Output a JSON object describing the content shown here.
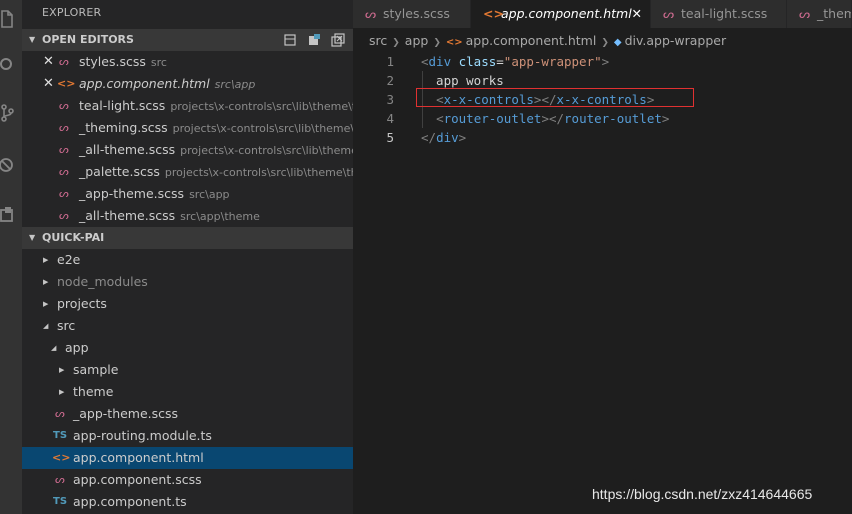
{
  "colors": {
    "activity_bar": "#333333",
    "sidebar_bg": "#252526",
    "editor_bg": "#1e1e1e",
    "selection": "#094771",
    "highlight_box": "#e03131",
    "sass_icon": "#cd6b8f",
    "html_icon": "#e37933",
    "ts_icon": "#519aba"
  },
  "activity_bar": {
    "items": [
      "files-icon",
      "search-icon",
      "source-control-icon",
      "debug-icon",
      "extensions-icon"
    ]
  },
  "sidebar": {
    "title": "EXPLORER",
    "open_editors": {
      "header": "OPEN EDITORS",
      "items": [
        {
          "name": "styles.scss",
          "path": "src",
          "icon": "sass-icon",
          "close": "✕"
        },
        {
          "name": "app.component.html",
          "path": "src\\app",
          "icon": "html-icon",
          "close": "✕"
        },
        {
          "name": "teal-light.scss",
          "path": "projects\\x-controls\\src\\lib\\theme\\t...",
          "icon": "sass-icon"
        },
        {
          "name": "_theming.scss",
          "path": "projects\\x-controls\\src\\lib\\theme\\t...",
          "icon": "sass-icon"
        },
        {
          "name": "_all-theme.scss",
          "path": "projects\\x-controls\\src\\lib\\theme...",
          "icon": "sass-icon"
        },
        {
          "name": "_palette.scss",
          "path": "projects\\x-controls\\src\\lib\\theme\\th...",
          "icon": "sass-icon"
        },
        {
          "name": "_app-theme.scss",
          "path": "src\\app",
          "icon": "sass-icon"
        },
        {
          "name": "_all-theme.scss",
          "path": "src\\app\\theme",
          "icon": "sass-icon"
        }
      ]
    },
    "project": {
      "header": "QUICK-PAI",
      "tree": [
        {
          "name": "e2e",
          "type": "folder",
          "expanded": false
        },
        {
          "name": "node_modules",
          "type": "folder",
          "expanded": false
        },
        {
          "name": "projects",
          "type": "folder",
          "expanded": false
        },
        {
          "name": "src",
          "type": "folder",
          "expanded": true
        },
        {
          "name": "app",
          "type": "folder",
          "expanded": true
        },
        {
          "name": "sample",
          "type": "folder",
          "expanded": false
        },
        {
          "name": "theme",
          "type": "folder",
          "expanded": false
        },
        {
          "name": "_app-theme.scss",
          "type": "file",
          "icon": "sass-icon"
        },
        {
          "name": "app-routing.module.ts",
          "type": "file",
          "icon": "ts-icon"
        },
        {
          "name": "app.component.html",
          "type": "file",
          "icon": "html-icon",
          "selected": true
        },
        {
          "name": "app.component.scss",
          "type": "file",
          "icon": "sass-icon"
        },
        {
          "name": "app.component.ts",
          "type": "file",
          "icon": "ts-icon"
        }
      ]
    }
  },
  "tabs": [
    {
      "label": "styles.scss",
      "icon": "sass-icon",
      "active": false
    },
    {
      "label": "app.component.html",
      "icon": "html-icon",
      "active": true,
      "close": "✕"
    },
    {
      "label": "teal-light.scss",
      "icon": "sass-icon",
      "active": false
    },
    {
      "label": "_them",
      "icon": "sass-icon",
      "active": false
    }
  ],
  "breadcrumb": [
    "src",
    "app",
    "app.component.html",
    "div.app-wrapper"
  ],
  "editor": {
    "line_numbers": [
      "1",
      "2",
      "3",
      "4",
      "5"
    ],
    "current_line": "5",
    "lines": [
      "<div class=\"app-wrapper\">",
      "  app works",
      "  <x-x-controls></x-x-controls>",
      "  <router-outlet></router-outlet>",
      "</div>"
    ]
  },
  "watermark": "https://blog.csdn.net/zxz414644665"
}
